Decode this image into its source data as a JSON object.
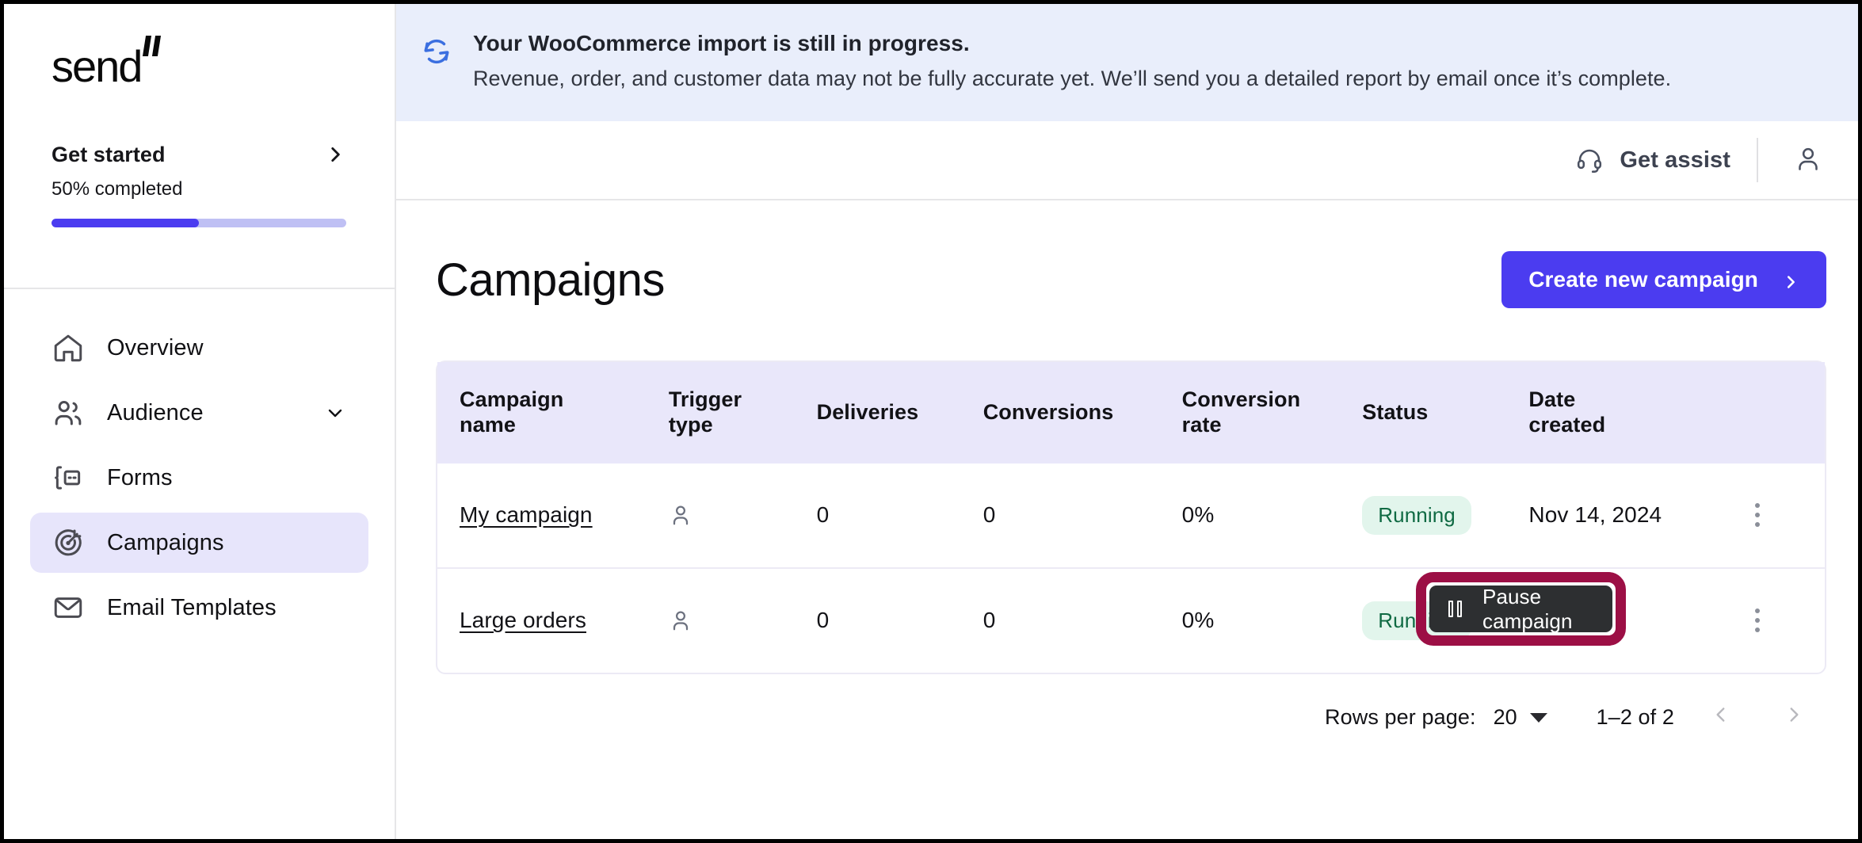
{
  "brand": {
    "logo_text": "send"
  },
  "sidebar": {
    "get_started": {
      "title": "Get started",
      "progress_text": "50% completed",
      "progress_percent": 50,
      "accent_color": "#4b3cf0",
      "track_color": "#bfc0f4"
    },
    "items": [
      {
        "label": "Overview",
        "icon": "home-icon",
        "active": false,
        "has_caret": false
      },
      {
        "label": "Audience",
        "icon": "users-icon",
        "active": false,
        "has_caret": true
      },
      {
        "label": "Forms",
        "icon": "form-icon",
        "active": false,
        "has_caret": false
      },
      {
        "label": "Campaigns",
        "icon": "target-icon",
        "active": true,
        "has_caret": false
      },
      {
        "label": "Email Templates",
        "icon": "envelope-icon",
        "active": false,
        "has_caret": false
      }
    ],
    "active_item_bg": "#e7e5fb"
  },
  "banner": {
    "icon": "sync-icon",
    "icon_color": "#3b6fe0",
    "background": "#e9eefb",
    "headline": "Your WooCommerce import is still in progress.",
    "detail": "Revenue, order, and customer data may not be fully accurate yet. We’ll send you a detailed report by email once it’s complete."
  },
  "topbar": {
    "assist_label": "Get assist",
    "assist_icon": "headset-icon",
    "account_icon": "person-icon"
  },
  "page": {
    "title": "Campaigns",
    "create_button": "Create new campaign",
    "create_button_color": "#4b3cf0"
  },
  "table": {
    "header_bg": "#e9e7fa",
    "columns": [
      {
        "line1": "Campaign",
        "line2": "name"
      },
      {
        "line1": "Trigger",
        "line2": "type"
      },
      {
        "line1": "Deliveries",
        "line2": ""
      },
      {
        "line1": "Conversions",
        "line2": ""
      },
      {
        "line1": "Conversion",
        "line2": "rate"
      },
      {
        "line1": "Status",
        "line2": ""
      },
      {
        "line1": "Date",
        "line2": "created"
      }
    ],
    "rows": [
      {
        "name": "My campaign",
        "trigger_icon": "person-icon",
        "deliveries": "0",
        "conversions": "0",
        "conversion_rate": "0%",
        "status": "Running",
        "status_bg": "#e2f5ec",
        "status_color": "#0f6a43",
        "date_created": "Nov 14, 2024",
        "menu_icon": "kebab-menu-icon"
      },
      {
        "name": "Large orders",
        "trigger_icon": "person-icon",
        "deliveries": "0",
        "conversions": "0",
        "conversion_rate": "0%",
        "status": "Running",
        "status_bg": "#e2f5ec",
        "status_color": "#0f6a43",
        "date_created": "",
        "menu_icon": "kebab-menu-icon"
      }
    ]
  },
  "pagination": {
    "rows_per_page_label": "Rows per page:",
    "rows_per_page_value": "20",
    "range_text": "1–2 of 2",
    "prev_icon": "chevron-left-icon",
    "next_icon": "chevron-right-icon"
  },
  "overlay": {
    "tooltip_label": "Pause campaign",
    "tooltip_icon": "pause-icon",
    "tooltip_bg": "#2d2f31",
    "highlight_color": "#9c0f45"
  }
}
